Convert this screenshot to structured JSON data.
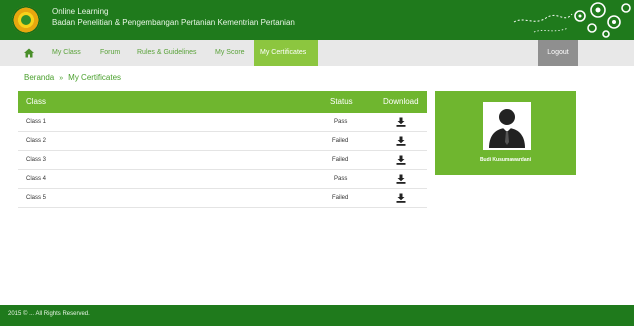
{
  "header": {
    "title": "Online Learning",
    "subtitle": "Badan Penelitian & Pengembangan Pertanian Kementrian Pertanian"
  },
  "nav": {
    "items": [
      {
        "label": "My Class"
      },
      {
        "label": "Forum"
      },
      {
        "label": "Rules & Guidelines"
      },
      {
        "label": "My Score"
      },
      {
        "label": "My Certificates",
        "active": true
      }
    ],
    "logout": "Logout"
  },
  "breadcrumb": {
    "home": "Beranda",
    "separator": "»",
    "current": "My Certificates"
  },
  "table": {
    "headers": {
      "class": "Class",
      "status": "Status",
      "download": "Download"
    },
    "rows": [
      {
        "class": "Class 1",
        "status": "Pass"
      },
      {
        "class": "Class 2",
        "status": "Failed"
      },
      {
        "class": "Class 3",
        "status": "Failed"
      },
      {
        "class": "Class 4",
        "status": "Pass"
      },
      {
        "class": "Class 5",
        "status": "Failed"
      }
    ]
  },
  "profile": {
    "name": "Budi Kusumawardani"
  },
  "footer": {
    "text": "2015 © ... All Rights Reserved."
  },
  "colors": {
    "header_green": "#1f7a1c",
    "accent_green": "#6fb62f",
    "active_tab": "#8cc63f",
    "logout_gray": "#8f8f8f"
  }
}
